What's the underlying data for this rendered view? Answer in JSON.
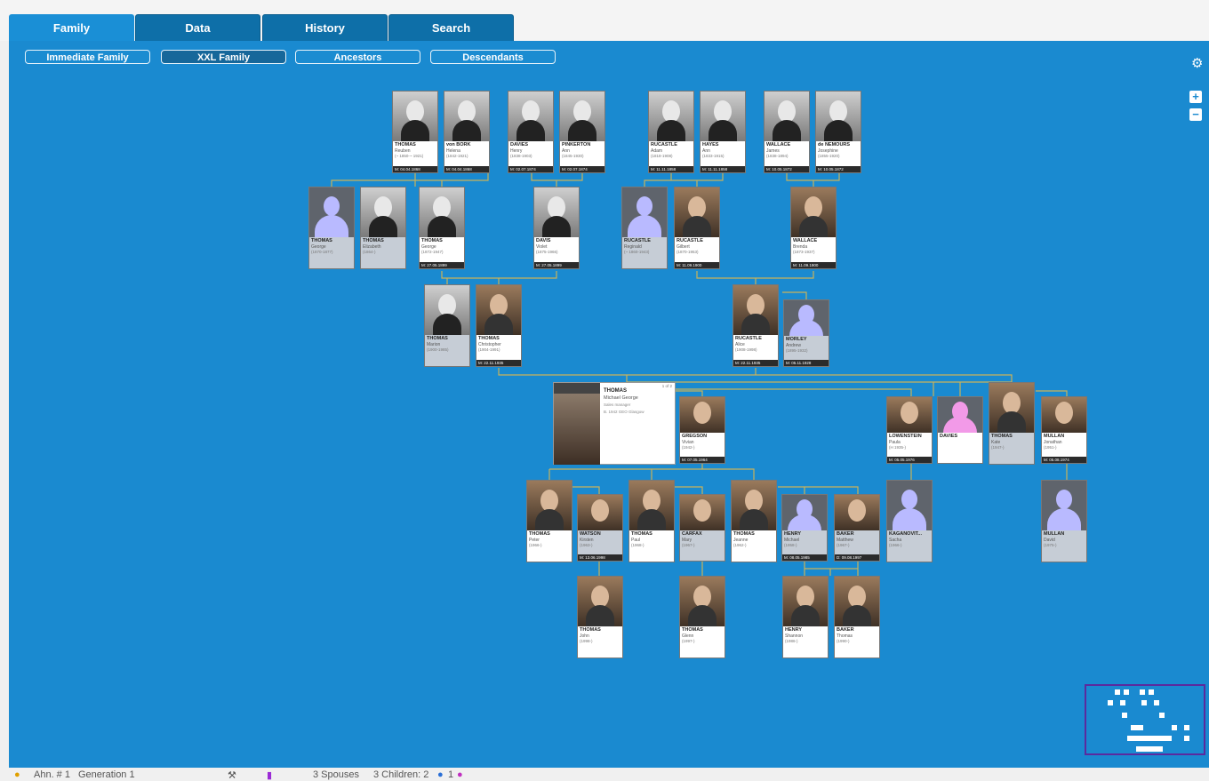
{
  "tabs": [
    {
      "label": "Family"
    },
    {
      "label": "Data"
    },
    {
      "label": "History"
    },
    {
      "label": "Search"
    }
  ],
  "subtabs": [
    {
      "label": "Immediate Family"
    },
    {
      "label": "XXL Family"
    },
    {
      "label": "Ancestors"
    },
    {
      "label": "Descendants"
    }
  ],
  "controls": {
    "zoom_in": "+",
    "zoom_out": "−",
    "settings_icon": "gear-icon"
  },
  "persons": {
    "reuben": {
      "surname": "THOMAS",
      "given": "Reuben",
      "years": "(~ 1850-~ 1921)",
      "marr": "M: 04.04.1868"
    },
    "helena": {
      "surname": "von BORK",
      "given": "Helena",
      "years": "(1842-1921)",
      "marr": "M: 04.04.1868"
    },
    "henry": {
      "surname": "DAVIES",
      "given": "Henry",
      "years": "(1838-1903)",
      "marr": "M: 02.07.1874"
    },
    "ann": {
      "surname": "PINKERTON",
      "given": "Ann",
      "years": "(1845-1930)",
      "marr": "M: 02.07.1874"
    },
    "adam": {
      "surname": "RUCASTLE",
      "given": "Adam",
      "years": "(1818-1908)",
      "marr": "M: 11.11.1858"
    },
    "annh": {
      "surname": "HAYES",
      "given": "Ann",
      "years": "(1833-1915)",
      "marr": "M: 11.11.1858"
    },
    "james": {
      "surname": "WALLACE",
      "given": "James",
      "years": "(1838-1894)",
      "marr": "M: 10.05.1872"
    },
    "josephine": {
      "surname": "de NEMOURS",
      "given": "Josephine",
      "years": "(1855-1920)",
      "marr": "M: 10.05.1872"
    },
    "george1": {
      "surname": "THOMAS",
      "given": "George",
      "years": "(1870-1877)",
      "marr": ""
    },
    "elizabeth": {
      "surname": "THOMAS",
      "given": "Elizabeth",
      "years": "(1864-)",
      "marr": ""
    },
    "george2": {
      "surname": "THOMAS",
      "given": "George",
      "years": "(1872-1947)",
      "marr": "M: 27.05.1899"
    },
    "violet": {
      "surname": "DAVIS",
      "given": "Violet",
      "years": "(1875-1966)",
      "marr": "M: 27.05.1899"
    },
    "reginald": {
      "surname": "RUCASTLE",
      "given": "Reginald",
      "years": "(~ 1860-1943)",
      "marr": ""
    },
    "gilbert": {
      "surname": "RUCASTLE",
      "given": "Gilbert",
      "years": "(1870-1953)",
      "marr": "M: 11.09.1900"
    },
    "brenda": {
      "surname": "WALLACE",
      "given": "Brenda",
      "years": "(1873-1937)",
      "marr": "M: 11.09.1900"
    },
    "marion": {
      "surname": "THOMAS",
      "given": "Marion",
      "years": "(1900-1985)",
      "marr": ""
    },
    "christopher": {
      "surname": "THOMAS",
      "given": "Christopher",
      "years": "(1904-1991)",
      "marr": "M: 22.11.1935"
    },
    "alice": {
      "surname": "RUCASTLE",
      "given": "Alice",
      "years": "(1908-1998)",
      "marr": "M: 22.11.1935"
    },
    "andrew": {
      "surname": "MORLEY",
      "given": "Andrew",
      "years": "(1895-1932)",
      "marr": "M: 05.11.1928"
    },
    "vivian": {
      "surname": "GREGSON",
      "given": "Vivian",
      "years": "(1942-)",
      "marr": "M: 07.05.1964"
    },
    "paula": {
      "surname": "LOWENSTEIN",
      "given": "Paula",
      "years": "(H 1935-)",
      "marr": "M: 05.05.1976"
    },
    "daviesf": {
      "surname": "DAVIES",
      "given": "",
      "years": "",
      "marr": ""
    },
    "kate": {
      "surname": "THOMAS",
      "given": "Kate",
      "years": "(1947-)",
      "marr": ""
    },
    "jonathan": {
      "surname": "MULLAN",
      "given": "Jonathan",
      "years": "(1951-)",
      "marr": "M: 05.08.1974"
    },
    "peter": {
      "surname": "THOMAS",
      "given": "Peter",
      "years": "(1966-)",
      "marr": ""
    },
    "kirsten": {
      "surname": "WATSON",
      "given": "Kirsten",
      "years": "(1963-)",
      "marr": "M: 13.06.1998"
    },
    "paul": {
      "surname": "THOMAS",
      "given": "Paul",
      "years": "(1968-)",
      "marr": ""
    },
    "mary": {
      "surname": "CARFAX",
      "given": "Mary",
      "years": "(1967-)",
      "marr": ""
    },
    "jeanne": {
      "surname": "THOMAS",
      "given": "Jeanne",
      "years": "(1962-)",
      "marr": ""
    },
    "michael": {
      "surname": "HENRY",
      "given": "Michael",
      "years": "(1958-)",
      "marr": "M: 08.05.1985"
    },
    "matthew": {
      "surname": "BAKER",
      "given": "Matthew",
      "years": "(1967-)",
      "marr": "D: 09.08.1997"
    },
    "sacha": {
      "surname": "KAGANOVIT...",
      "given": "Sacha",
      "years": "(1966-)",
      "marr": ""
    },
    "david": {
      "surname": "MULLAN",
      "given": "David",
      "years": "(1975-)",
      "marr": ""
    },
    "john": {
      "surname": "THOMAS",
      "given": "John",
      "years": "(1998-)",
      "marr": ""
    },
    "glenn": {
      "surname": "THOMAS",
      "given": "Glenn",
      "years": "(1997-)",
      "marr": ""
    },
    "shannon": {
      "surname": "HENRY",
      "given": "Shannon",
      "years": "(1986-)",
      "marr": ""
    },
    "thomasb": {
      "surname": "BAKER",
      "given": "Thomas",
      "years": "(1990-)",
      "marr": ""
    }
  },
  "main_person": {
    "surname": "THOMAS",
    "given": "Michael George",
    "occupation": "Sales manager",
    "place": "B. 1942 GEO\nGlasgow",
    "index": "1 of 2"
  },
  "status": {
    "ahn": "Ahn. # 1",
    "generation": "Generation 1",
    "spouses": "3 Spouses",
    "children": "3 Children: 2",
    "children_f": "1"
  },
  "colors": {
    "canvas": "#1a8ad0",
    "tab_active": "#1a8fd6",
    "tab": "#0e6fa8",
    "line": "#c9b25a"
  }
}
